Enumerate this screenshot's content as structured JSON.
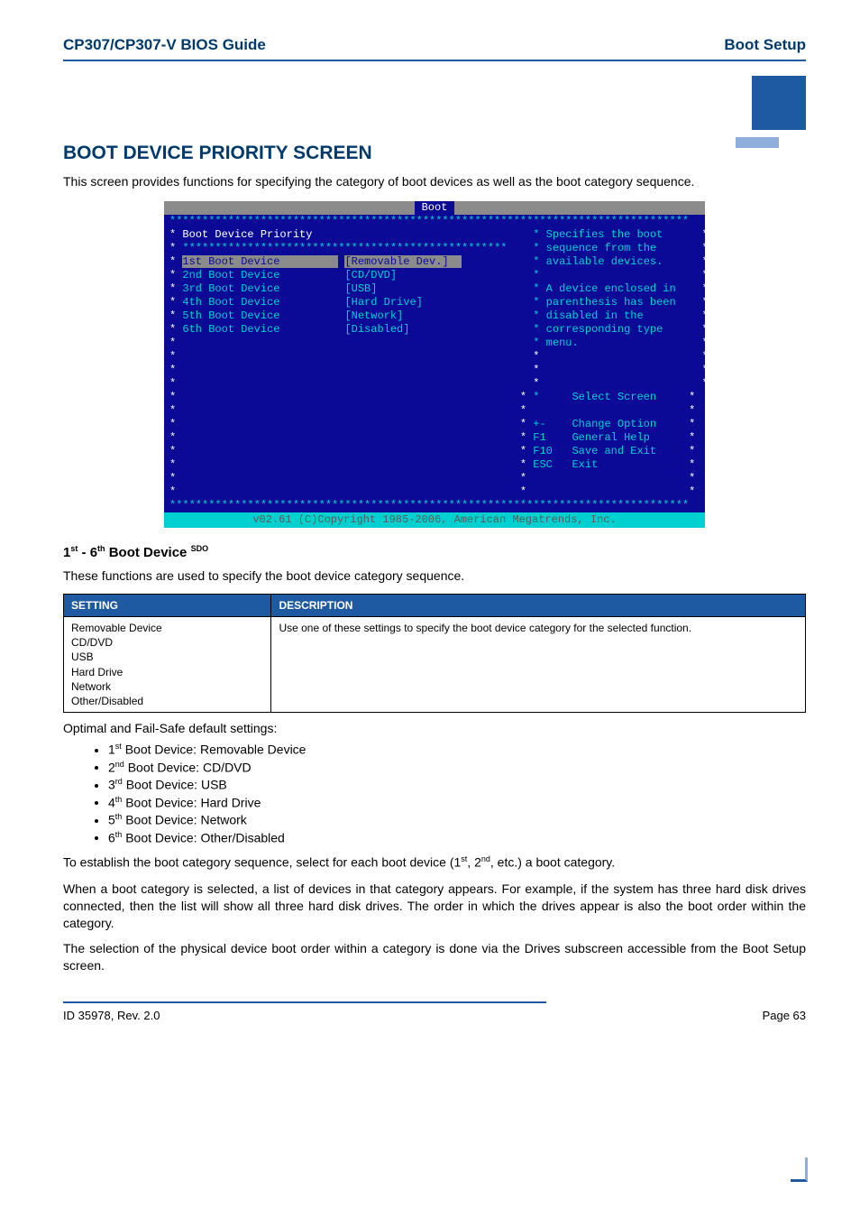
{
  "header": {
    "left": "CP307/CP307-V BIOS Guide",
    "right": "Boot Setup"
  },
  "section": {
    "title": "BOOT DEVICE PRIORITY SCREEN",
    "intro": "This screen provides functions for specifying the category of boot devices as well as the boot category sequence."
  },
  "bios": {
    "tab": "Boot",
    "menu_title": "Boot Device Priority",
    "devices": [
      {
        "label": "1st Boot Device",
        "value": "[Removable Dev.]"
      },
      {
        "label": "2nd Boot Device",
        "value": "[CD/DVD]"
      },
      {
        "label": "3rd Boot Device",
        "value": "[USB]"
      },
      {
        "label": "4th Boot Device",
        "value": "[Hard Drive]"
      },
      {
        "label": "5th Boot Device",
        "value": "[Network]"
      },
      {
        "label": "6th Boot Device",
        "value": "[Disabled]"
      }
    ],
    "help": [
      "Specifies the boot",
      "sequence from the",
      "available devices.",
      "",
      "A device enclosed in",
      "parenthesis has been",
      "disabled in the",
      "corresponding type",
      "menu."
    ],
    "nav": [
      {
        "key": "*",
        "label": "Select Screen"
      },
      {
        "key": "",
        "label": ""
      },
      {
        "key": "+-",
        "label": "Change Option"
      },
      {
        "key": "F1",
        "label": "General Help"
      },
      {
        "key": "F10",
        "label": "Save and Exit"
      },
      {
        "key": "ESC",
        "label": "Exit"
      }
    ],
    "footer": "v02.61 (C)Copyright 1985-2006, American Megatrends, Inc."
  },
  "sub": {
    "heading": "1st - 6th Boot Device",
    "sdo": "SDO",
    "desc": "These functions are used to specify the boot device category sequence.",
    "table": {
      "col1": "SETTING",
      "col2": "DESCRIPTION",
      "settings": "Removable Device\nCD/DVD\nUSB\nHard Drive\nNetwork\nOther/Disabled",
      "description": "Use one of these settings to specify the boot device category for the selected function."
    },
    "defaults_intro": "Optimal and Fail-Safe default settings:",
    "defaults": [
      "1st Boot Device:  Removable Device",
      "2nd Boot Device: CD/DVD",
      "3rd Boot Device:  USB",
      "4th Boot Device:  Hard Drive",
      "5th Boot Device:  Network",
      "6th Boot Device:  Other/Disabled"
    ],
    "p1": "To establish the boot category sequence, select for each boot device (1st, 2nd, etc.) a boot category.",
    "p2": "When a boot category is selected, a list of devices in that category appears. For example, if the system has three hard disk drives connected, then the list will show all three hard disk drives. The order in which the drives appear is also the boot order within the category.",
    "p3": "The selection of the physical device boot order within a category is done via the Drives subscreen accessible from the Boot Setup screen."
  },
  "footer": {
    "left": "ID 35978, Rev. 2.0",
    "right": "Page 63"
  }
}
